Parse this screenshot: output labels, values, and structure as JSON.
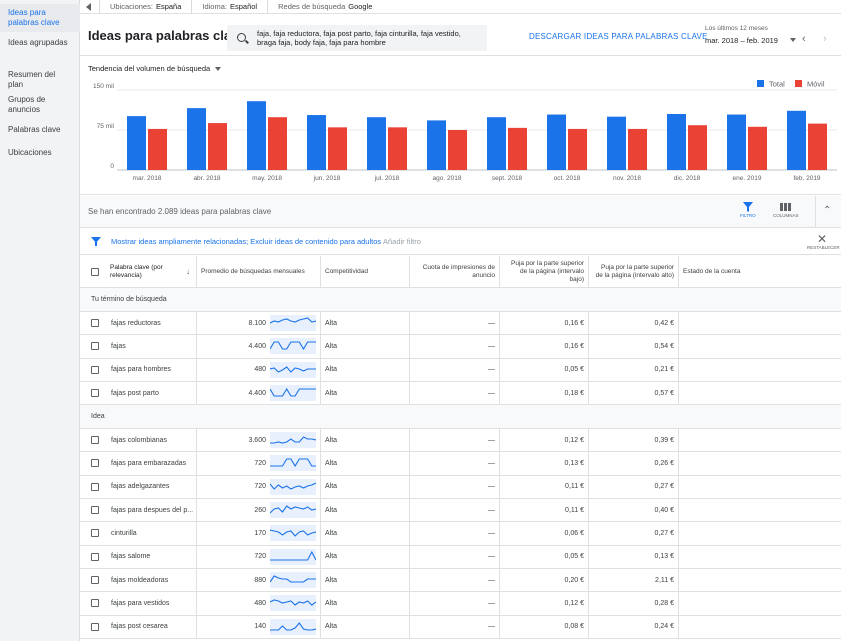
{
  "sidebar": {
    "items": [
      {
        "label": "Ideas para palabras clave",
        "active": true
      },
      {
        "label": "Ideas agrupadas"
      },
      {
        "label": "Resumen del plan"
      },
      {
        "label": "Grupos de anuncios"
      },
      {
        "label": "Palabras clave"
      },
      {
        "label": "Ubicaciones"
      }
    ]
  },
  "topbar": {
    "location_label": "Ubicaciones:",
    "location_value": "España",
    "language_label": "Idioma:",
    "language_value": "Español",
    "network_label": "Redes de búsqueda",
    "network_value": "Google"
  },
  "header": {
    "title": "Ideas para palabras clave",
    "search_text": "faja, faja reductora, faja post parto, faja cinturilla, faja vestido, braga faja, body faja, faja para hombre",
    "download_label": "DESCARGAR IDEAS PARA PALABRAS CLAVE",
    "period_label": "Los últimos 12 meses",
    "period_value": "mar. 2018 – feb. 2019"
  },
  "chart": {
    "selector_label": "Tendencia del volumen de búsqueda"
  },
  "chart_data": {
    "type": "bar",
    "categories": [
      "mar. 2018",
      "abr. 2018",
      "may. 2018",
      "jun. 2018",
      "jul. 2018",
      "ago. 2018",
      "sept. 2018",
      "oct. 2018",
      "nov. 2018",
      "dic. 2018",
      "ene. 2019",
      "feb. 2019"
    ],
    "series": [
      {
        "name": "Total",
        "color": "#1a73e8",
        "values": [
          101,
          116,
          129,
          103,
          99,
          93,
          99,
          104,
          100,
          105,
          104,
          111
        ]
      },
      {
        "name": "Móvil",
        "color": "#ea4335",
        "values": [
          77,
          88,
          99,
          80,
          80,
          75,
          79,
          77,
          77,
          84,
          81,
          87
        ]
      }
    ],
    "yticks": [
      "0",
      "75 mil",
      "150 mil"
    ],
    "ytick_values": [
      0,
      75,
      150
    ],
    "ylim": [
      0,
      150
    ],
    "legend_position": "top-right",
    "grid": true
  },
  "summary": {
    "text": "Se han encontrado 2.089 ideas para palabras clave",
    "filter_label": "FILTRO",
    "columns_label": "COLUMNAS"
  },
  "filters": {
    "active_text": "Mostrar ideas ampliamente relacionadas; Excluir ideas de contenido para adultos",
    "add_text": "Añadir filtro",
    "reset_label": "RESTABLECER"
  },
  "table": {
    "headers": {
      "keyword": "Palabra clave (por relevancia)",
      "avg": "Promedio de búsquedas mensuales",
      "comp": "Competitividad",
      "share": "Cuota de impresiones de anuncio",
      "bid_low": "Puja por la parte superior de la página (intervalo bajo)",
      "bid_high": "Puja por la parte superior de la página (intervalo alto)",
      "status": "Estado de la cuenta"
    },
    "section_search": "Tu término de búsqueda",
    "section_ideas": "Idea",
    "search_rows": [
      {
        "keyword": "fajas reductoras",
        "avg": "8.100",
        "comp": "Alta",
        "share": "—",
        "low": "0,16 €",
        "high": "0,42 €",
        "spark": [
          8,
          10,
          9,
          11,
          12,
          10,
          9,
          11,
          12,
          13,
          9,
          10
        ]
      },
      {
        "keyword": "fajas",
        "avg": "4.400",
        "comp": "Alta",
        "share": "—",
        "low": "0,16 €",
        "high": "0,54 €",
        "spark": [
          5,
          12,
          12,
          5,
          5,
          12,
          12,
          12,
          5,
          12,
          12,
          12
        ]
      },
      {
        "keyword": "fajas para hombres",
        "avg": "480",
        "comp": "Alta",
        "share": "—",
        "low": "0,05 €",
        "high": "0,21 €",
        "spark": [
          9,
          10,
          6,
          8,
          11,
          6,
          10,
          9,
          7,
          9,
          9,
          9
        ]
      },
      {
        "keyword": "fajas post parto",
        "avg": "4.400",
        "comp": "Alta",
        "share": "—",
        "low": "0,18 €",
        "high": "0,57 €",
        "spark": [
          12,
          5,
          5,
          5,
          12,
          5,
          5,
          12,
          12,
          12,
          12,
          12
        ]
      }
    ],
    "idea_rows": [
      {
        "keyword": "fajas colombianas",
        "avg": "3.600",
        "comp": "Alta",
        "share": "—",
        "low": "0,12 €",
        "high": "0,39 €",
        "spark": [
          5,
          5,
          6,
          5,
          6,
          9,
          6,
          6,
          11,
          9,
          9,
          8
        ]
      },
      {
        "keyword": "fajas para embarazadas",
        "avg": "720",
        "comp": "Alta",
        "share": "—",
        "low": "0,13 €",
        "high": "0,26 €",
        "spark": [
          5,
          5,
          5,
          5,
          12,
          12,
          5,
          12,
          12,
          12,
          5,
          5
        ]
      },
      {
        "keyword": "fajas adelgazantes",
        "avg": "720",
        "comp": "Alta",
        "share": "—",
        "low": "0,11 €",
        "high": "0,27 €",
        "spark": [
          11,
          6,
          10,
          7,
          9,
          6,
          8,
          9,
          7,
          9,
          10,
          12
        ]
      },
      {
        "keyword": "fajas para despues del p...",
        "avg": "260",
        "comp": "Alta",
        "share": "—",
        "low": "0,11 €",
        "high": "0,40 €",
        "spark": [
          5,
          9,
          10,
          6,
          12,
          9,
          11,
          10,
          9,
          11,
          8,
          9
        ]
      },
      {
        "keyword": "cinturilla",
        "avg": "170",
        "comp": "Alta",
        "share": "—",
        "low": "0,06 €",
        "high": "0,27 €",
        "spark": [
          11,
          10,
          9,
          6,
          9,
          10,
          5,
          9,
          10,
          6,
          8,
          9
        ]
      },
      {
        "keyword": "fajas salome",
        "avg": "720",
        "comp": "Alta",
        "share": "—",
        "low": "0,05 €",
        "high": "0,13 €",
        "spark": [
          5,
          5,
          5,
          5,
          5,
          5,
          5,
          5,
          5,
          5,
          13,
          5
        ]
      },
      {
        "keyword": "fajas moldeadoras",
        "avg": "880",
        "comp": "Alta",
        "share": "—",
        "low": "0,20 €",
        "high": "2,11 €",
        "spark": [
          6,
          12,
          10,
          9,
          9,
          6,
          6,
          6,
          6,
          9,
          9,
          9
        ]
      },
      {
        "keyword": "fajas para vestidos",
        "avg": "480",
        "comp": "Alta",
        "share": "—",
        "low": "0,12 €",
        "high": "0,28 €",
        "spark": [
          9,
          11,
          10,
          8,
          9,
          10,
          6,
          9,
          8,
          10,
          6,
          9
        ]
      },
      {
        "keyword": "fajas post cesarea",
        "avg": "140",
        "comp": "Alta",
        "share": "—",
        "low": "0,08 €",
        "high": "0,24 €",
        "spark": [
          5,
          5,
          5,
          9,
          5,
          5,
          7,
          12,
          6,
          5,
          5,
          6
        ]
      }
    ]
  }
}
